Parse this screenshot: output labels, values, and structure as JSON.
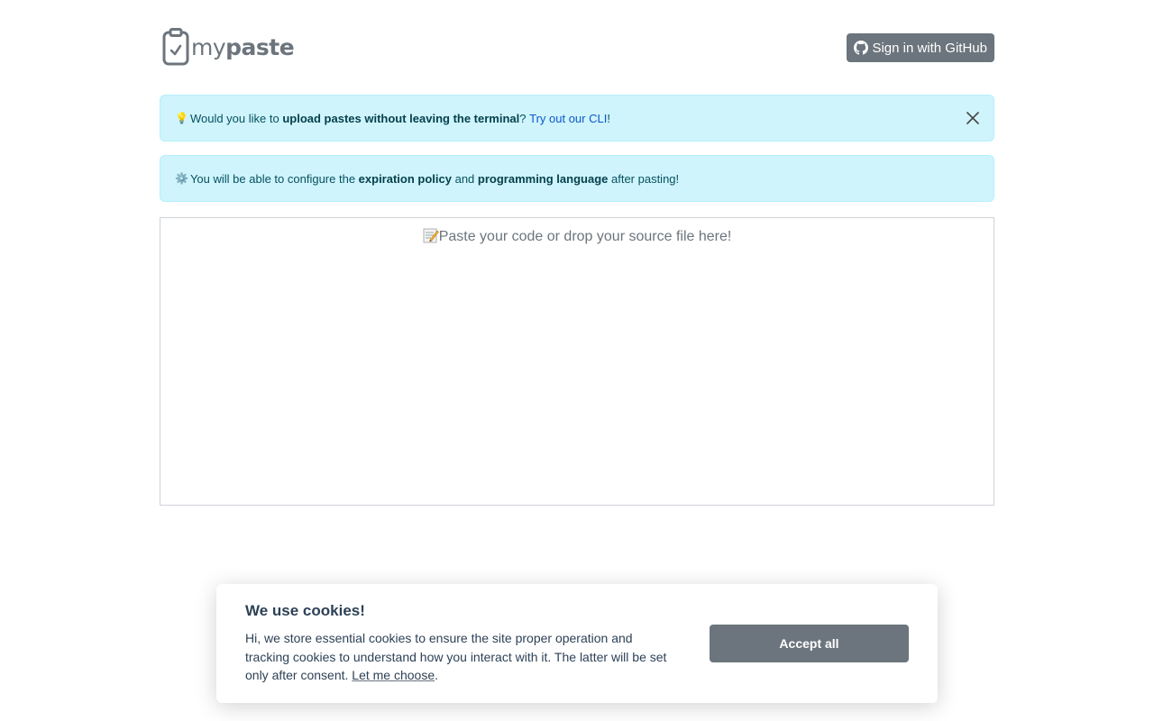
{
  "header": {
    "logo_light": "my",
    "logo_bold": "paste",
    "signin_label": "Sign in with GitHub"
  },
  "alerts": [
    {
      "icon": "lightbulb-icon",
      "emoji": "💡",
      "prefix": "Would you like to ",
      "bold": "upload pastes without leaving the terminal",
      "middle": "? ",
      "link": "Try out our CLI",
      "suffix": "!"
    },
    {
      "icon": "gear-icon",
      "emoji": "⚙️",
      "prefix": "You will be able to configure the ",
      "bold1": "expiration policy",
      "middle": " and ",
      "bold2": "programming language",
      "suffix": " after pasting!"
    }
  ],
  "editor": {
    "placeholder": "Paste your code or drop your source file here!",
    "icon": "memo-icon"
  },
  "cookie": {
    "title": "We use cookies!",
    "text": "Hi, we store essential cookies to ensure the site proper operation and tracking cookies to understand how you interact with it. The latter will be set only after consent. ",
    "link": "Let me choose",
    "suffix": ".",
    "accept_label": "Accept all"
  },
  "colors": {
    "alert_bg": "#cff4fc",
    "alert_text": "#055160",
    "secondary": "#6c757d",
    "link": "#0a58ca"
  }
}
